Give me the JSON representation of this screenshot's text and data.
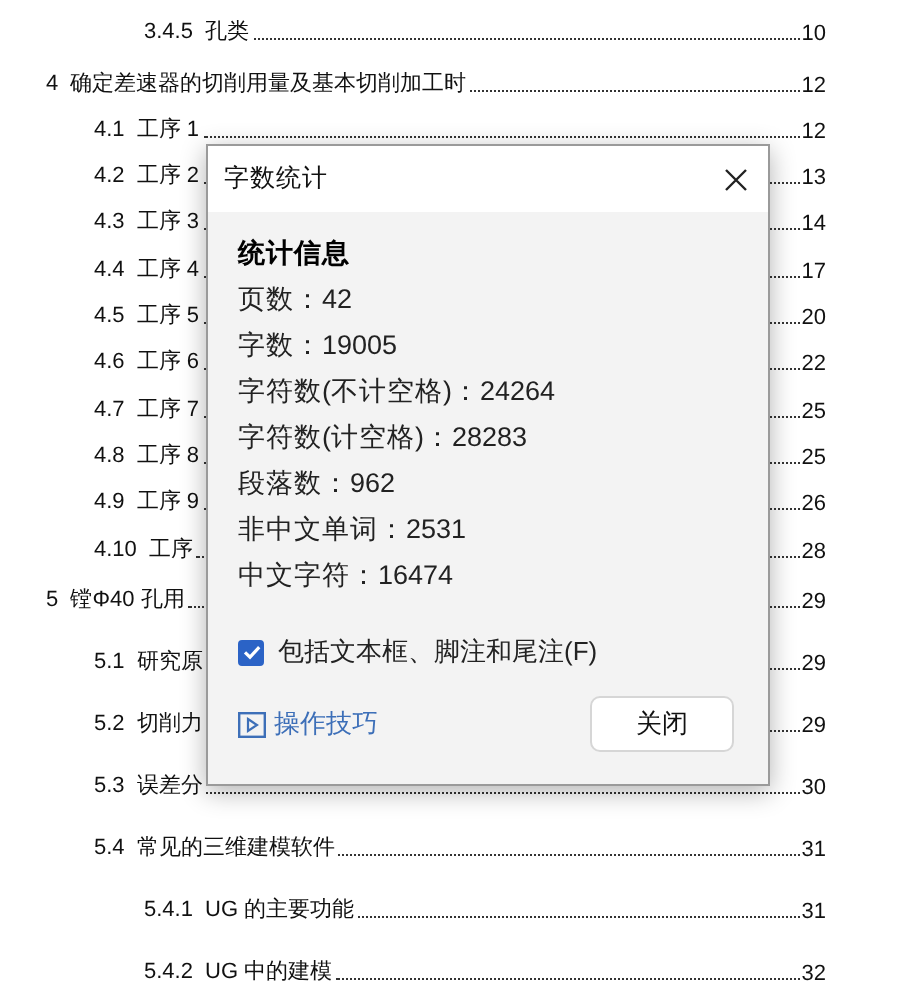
{
  "toc": [
    {
      "children": [
        {
          "children": [
            {
              "number": "3.4.5",
              "title": "孔类",
              "page": "10"
            }
          ]
        }
      ]
    },
    {
      "number": "4",
      "title": "确定差速器的切削用量及基本切削加工时",
      "page": "12",
      "children": [
        {
          "number": "4.1",
          "title": "工序 1",
          "page": "12"
        },
        {
          "number": "4.2",
          "title": "工序 2",
          "page": "13"
        },
        {
          "number": "4.3",
          "title": "工序 3",
          "page": "14"
        },
        {
          "number": "4.4",
          "title": "工序 4",
          "page": "17"
        },
        {
          "number": "4.5",
          "title": "工序 5",
          "page": "20"
        },
        {
          "number": "4.6",
          "title": "工序 6",
          "page": "22"
        },
        {
          "number": "4.7",
          "title": "工序 7",
          "page": "25"
        },
        {
          "number": "4.8",
          "title": "工序 8",
          "page": "25"
        },
        {
          "number": "4.9",
          "title": "工序 9",
          "page": "26"
        },
        {
          "number": "4.10",
          "title": "工序",
          "page": "28"
        }
      ]
    },
    {
      "number": "5",
      "title": "镗Φ40 孔用",
      "page": "29",
      "children": [
        {
          "number": "5.1",
          "title": "研究原",
          "page": "29"
        },
        {
          "number": "5.2",
          "title": "切削力",
          "page": "29"
        },
        {
          "number": "5.3",
          "title": "误差分",
          "page": "30"
        },
        {
          "number": "5.4",
          "title": "常见的三维建模软件",
          "page": "31",
          "children": [
            {
              "number": "5.4.1",
              "title": "UG 的主要功能",
              "page": "31"
            },
            {
              "number": "5.4.2",
              "title": "UG 中的建模",
              "page": "32"
            }
          ]
        }
      ]
    }
  ],
  "dialog": {
    "title": "字数统计",
    "heading": "统计信息",
    "stats": [
      {
        "label": "页数：",
        "value": "42"
      },
      {
        "label": "字数：",
        "value": "19005"
      },
      {
        "label": "字符数(不计空格)：",
        "value": "24264"
      },
      {
        "label": "字符数(计空格)：",
        "value": "28283"
      },
      {
        "label": "段落数：",
        "value": "962"
      },
      {
        "label": "非中文单词：",
        "value": "2531"
      },
      {
        "label": "中文字符：",
        "value": "16474"
      }
    ],
    "checkbox": {
      "label": "包括文本框、脚注和尾注(F)",
      "checked": true
    },
    "tips_link": "操作技巧",
    "close_button": "关闭"
  }
}
